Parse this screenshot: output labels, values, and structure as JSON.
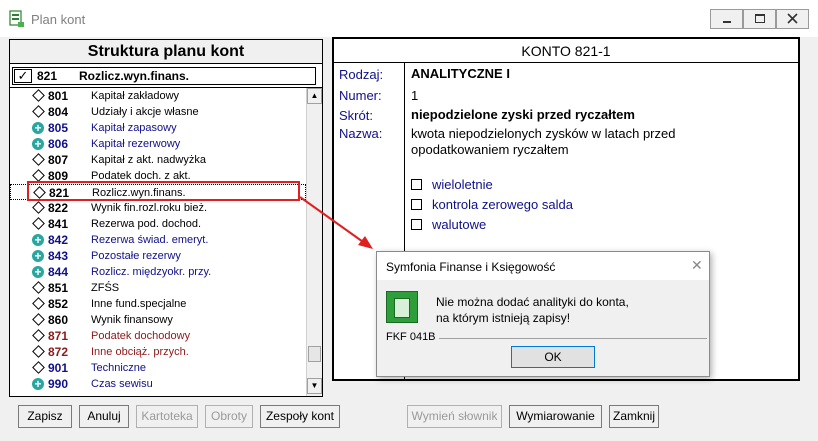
{
  "window": {
    "title": "Plan kont"
  },
  "left": {
    "header": "Struktura planu kont",
    "current": {
      "number": "821",
      "name": "Rozlicz.wyn.finans.",
      "check": "✓"
    },
    "rows": [
      {
        "num": "801",
        "name": "Kapitał zakładowy",
        "icon": "diamond",
        "color": "black"
      },
      {
        "num": "804",
        "name": "Udziały i akcje własne",
        "icon": "diamond",
        "color": "black"
      },
      {
        "num": "805",
        "name": "Kapitał zapasowy",
        "icon": "plus",
        "color": "blue"
      },
      {
        "num": "806",
        "name": "Kapitał rezerwowy",
        "icon": "plus",
        "color": "blue"
      },
      {
        "num": "807",
        "name": "Kapitał z akt. nadwyżka",
        "icon": "diamond",
        "color": "black"
      },
      {
        "num": "809",
        "name": "Podatek doch. z akt.",
        "icon": "diamond",
        "color": "black"
      },
      {
        "num": "821",
        "name": "Rozlicz.wyn.finans.",
        "icon": "diamond",
        "color": "black",
        "selected": true
      },
      {
        "num": "822",
        "name": "Wynik fin.rozl.roku bież.",
        "icon": "diamond",
        "color": "black"
      },
      {
        "num": "841",
        "name": "Rezerwa pod. dochod.",
        "icon": "diamond",
        "color": "black"
      },
      {
        "num": "842",
        "name": "Rezerwa świad. emeryt.",
        "icon": "plus",
        "color": "blue"
      },
      {
        "num": "843",
        "name": "Pozostałe rezerwy",
        "icon": "plus",
        "color": "blue"
      },
      {
        "num": "844",
        "name": "Rozlicz. międzyokr. przy.",
        "icon": "plus",
        "color": "blue"
      },
      {
        "num": "851",
        "name": "ZFŚS",
        "icon": "diamond",
        "color": "black"
      },
      {
        "num": "852",
        "name": "Inne fund.specjalne",
        "icon": "diamond",
        "color": "black"
      },
      {
        "num": "860",
        "name": "Wynik finansowy",
        "icon": "diamond",
        "color": "black"
      },
      {
        "num": "871",
        "name": "Podatek dochodowy",
        "icon": "diamond",
        "color": "red"
      },
      {
        "num": "872",
        "name": "Inne obciąż. przych.",
        "icon": "diamond",
        "color": "red"
      },
      {
        "num": "901",
        "name": "Techniczne",
        "icon": "diamond",
        "color": "blue"
      },
      {
        "num": "990",
        "name": "Czas sewisu",
        "icon": "plus",
        "color": "blue"
      }
    ]
  },
  "right": {
    "header": "KONTO  821-1",
    "fields": {
      "rodzaj_label": "Rodzaj:",
      "rodzaj_value": "ANALITYCZNE    I",
      "numer_label": "Numer:",
      "numer_value": "1",
      "skrot_label": "Skrót:",
      "skrot_value": "niepodzielone zyski przed ryczałtem",
      "nazwa_label": "Nazwa:",
      "nazwa_line1": "kwota niepodzielonych zysków w latach przed",
      "nazwa_line2": "opodatkowaniem ryczałtem"
    },
    "options": [
      "wieloletnie",
      "kontrola zerowego salda",
      "walutowe"
    ]
  },
  "dialog": {
    "title": "Symfonia Finanse i Księgowość",
    "message_line1": "Nie można dodać analityki do konta,",
    "message_line2": "na którym istnieją zapisy!",
    "code": "FKF 041B",
    "ok": "OK"
  },
  "buttons": {
    "zapisz": "Zapisz",
    "anuluj": "Anuluj",
    "kartoteka": "Kartoteka",
    "obroty": "Obroty",
    "zespoly": "Zespoły kont",
    "wymien": "Wymień słownik",
    "wymiarowanie": "Wymiarowanie",
    "zamknij": "Zamknij"
  },
  "colors": {
    "annotation": "#e02020",
    "accent_blue": "#10108a",
    "dark_red": "#8b1a1a",
    "teal_plus": "#2aa5a0"
  }
}
